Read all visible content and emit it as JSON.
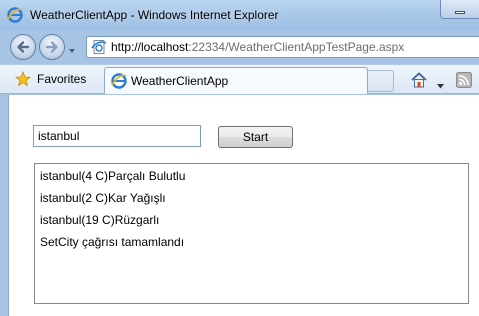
{
  "window": {
    "title": "WeatherClientApp - Windows Internet Explorer"
  },
  "address_bar": {
    "url_host": "http://localhost",
    "url_rest": ":22334/WeatherClientAppTestPage.aspx"
  },
  "favorites_bar": {
    "favorites_label": "Favorites"
  },
  "tab": {
    "label": "WeatherClientApp"
  },
  "page": {
    "city_input_value": "istanbul",
    "start_button_label": "Start",
    "results": [
      "istanbul(4 C)Parçalı Bulutlu",
      "istanbul(2 C)Kar Yağışlı",
      "istanbul(19 C)Rüzgarlı",
      "SetCity çağrısı tamamlandı"
    ]
  },
  "icons": {
    "app": "ie-icon",
    "back": "back-arrow-icon",
    "forward": "forward-arrow-icon",
    "page": "page-icon",
    "favorites": "star-icon",
    "home": "home-icon",
    "feeds": "rss-icon"
  },
  "colors": {
    "chrome_blue": "#a7c4e5",
    "window_bg": "#ffffff"
  }
}
